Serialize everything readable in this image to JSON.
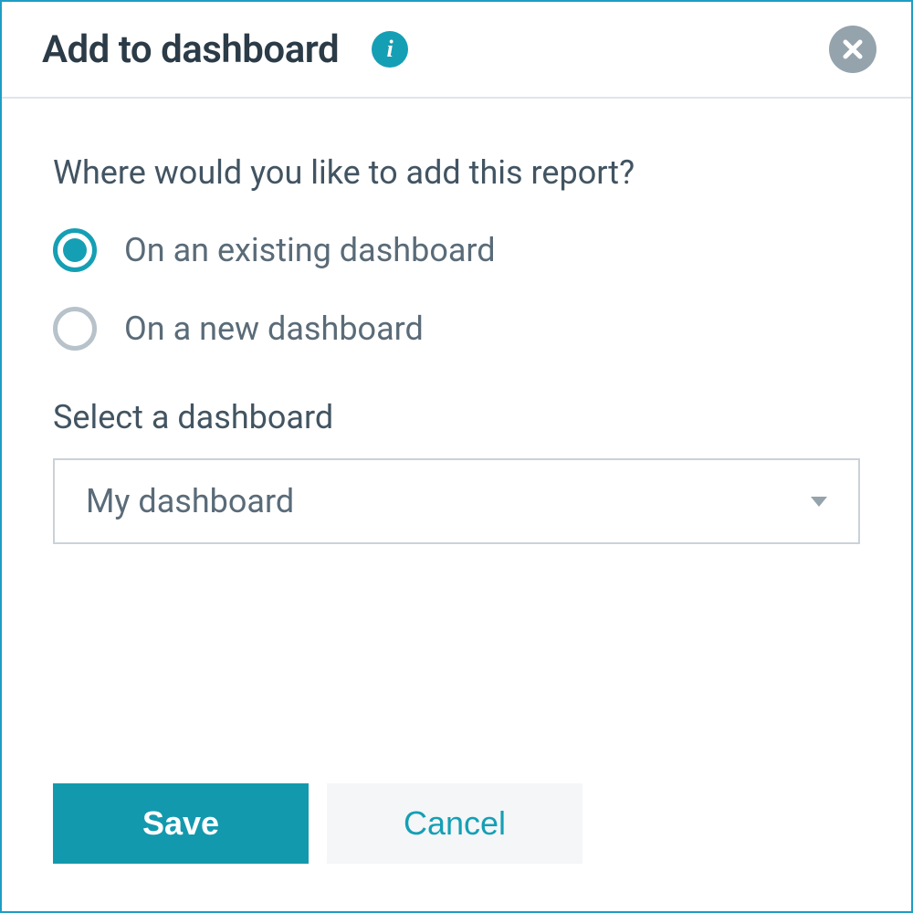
{
  "modal": {
    "title": "Add to dashboard",
    "question": "Where would you like to add this report?",
    "radio": {
      "existing": {
        "label": "On an existing dashboard",
        "selected": true
      },
      "new": {
        "label": "On a new dashboard",
        "selected": false
      }
    },
    "select": {
      "label": "Select a dashboard",
      "value": "My dashboard"
    },
    "buttons": {
      "save": "Save",
      "cancel": "Cancel"
    }
  }
}
